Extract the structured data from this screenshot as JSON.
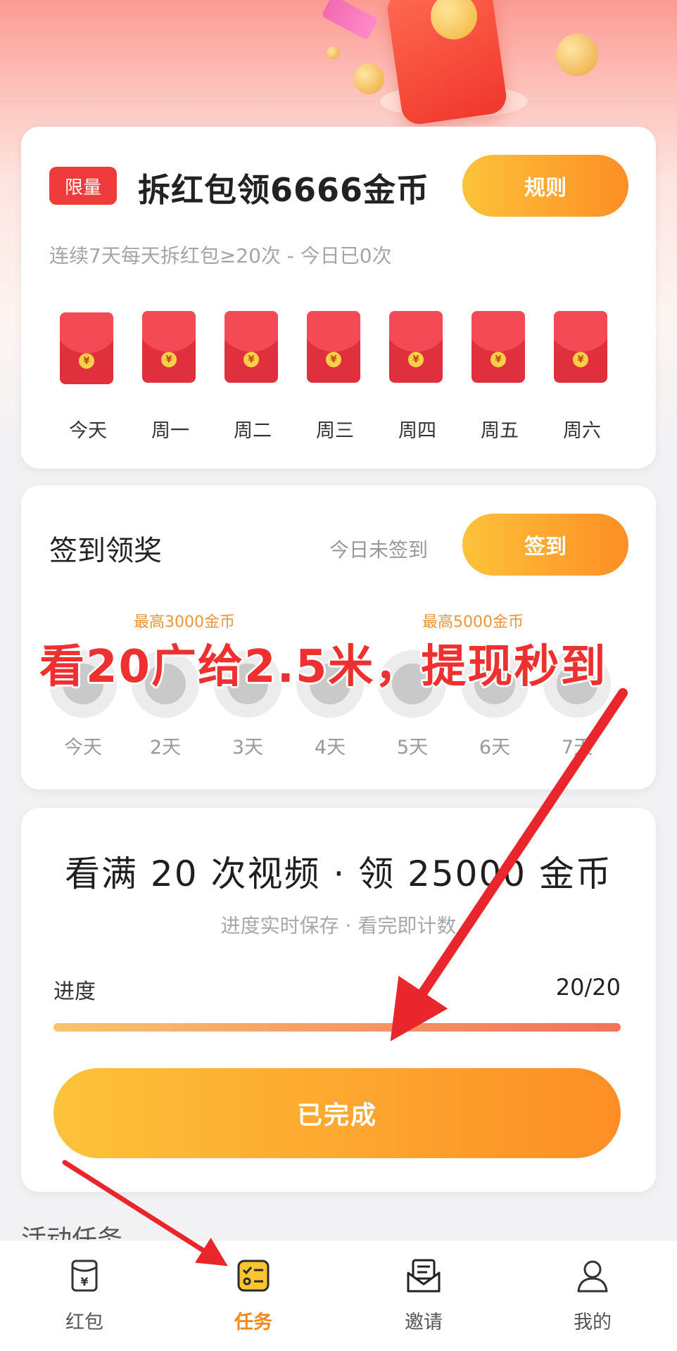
{
  "colors": {
    "accent_orange_start": "#fdc23a",
    "accent_orange_end": "#fd8e25",
    "red": "#ef3b3b",
    "active_tab": "#f28a1a"
  },
  "redpacket_card": {
    "tag": "限量",
    "title": "拆红包领6666金币",
    "rules_button": "规则",
    "subtitle": "连续7天每天拆红包≥20次 - 今日已0次",
    "envelope_symbol": "¥",
    "days": [
      "今天",
      "周一",
      "周二",
      "周三",
      "周四",
      "周五",
      "周六"
    ]
  },
  "signin_card": {
    "title": "签到领奖",
    "status": "今日未签到",
    "signin_button": "签到",
    "bonus_left": "最高3000金币",
    "bonus_right": "最高5000金币",
    "days": [
      "今天",
      "2天",
      "3天",
      "4天",
      "5天",
      "6天",
      "7天"
    ]
  },
  "overlay_caption": "看20广给2.5米，提现秒到",
  "video_card": {
    "title": "看满 20 次视频 · 领 25000 金币",
    "subtitle": "进度实时保存 · 看完即计数",
    "progress_label": "进度",
    "progress_text": "20/20",
    "progress_fraction": 1.0,
    "done_button": "已完成"
  },
  "section_title": "活动任务",
  "bottom_nav": {
    "items": [
      {
        "label": "红包",
        "icon": "red-packet-icon"
      },
      {
        "label": "任务",
        "icon": "task-list-icon",
        "active": true
      },
      {
        "label": "邀请",
        "icon": "invite-mail-icon"
      },
      {
        "label": "我的",
        "icon": "profile-icon"
      }
    ]
  }
}
